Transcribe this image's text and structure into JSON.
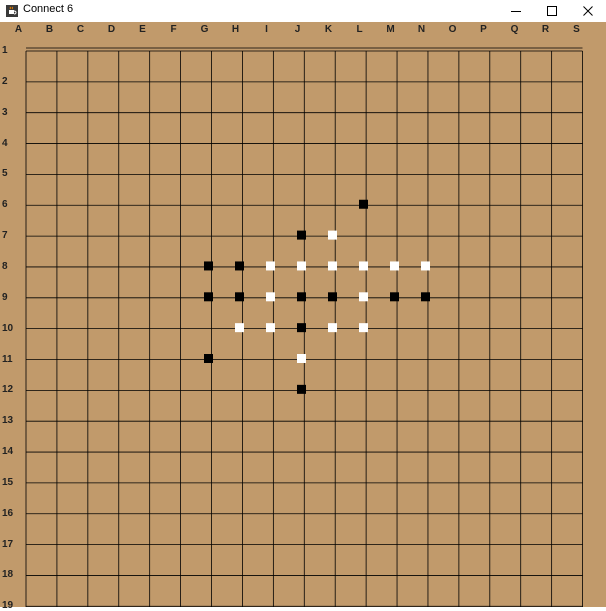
{
  "window": {
    "title": "Connect 6",
    "icon": "java-cup-icon",
    "controls": [
      "minimize-icon",
      "maximize-icon",
      "close-icon"
    ]
  },
  "board": {
    "size": 19,
    "columns": [
      "A",
      "B",
      "C",
      "D",
      "E",
      "F",
      "G",
      "H",
      "I",
      "J",
      "K",
      "L",
      "M",
      "N",
      "O",
      "P",
      "Q",
      "R",
      "S"
    ],
    "rows": [
      "1",
      "2",
      "3",
      "4",
      "5",
      "6",
      "7",
      "8",
      "9",
      "10",
      "11",
      "12",
      "13",
      "14",
      "15",
      "16",
      "17",
      "18",
      "19"
    ],
    "colors": {
      "board": "#c19a6b",
      "lines": "#000000",
      "black_stone": "#000000",
      "white_stone": "#ffffff"
    },
    "stones": {
      "black": [
        "L6",
        "J7",
        "G8",
        "H8",
        "G9",
        "H9",
        "J9",
        "K9",
        "M9",
        "N9",
        "J10",
        "G11",
        "J12"
      ],
      "white": [
        "K7",
        "I8",
        "J8",
        "K8",
        "L8",
        "M8",
        "N8",
        "I9",
        "L9",
        "H10",
        "I10",
        "K10",
        "L10",
        "J11"
      ]
    }
  }
}
